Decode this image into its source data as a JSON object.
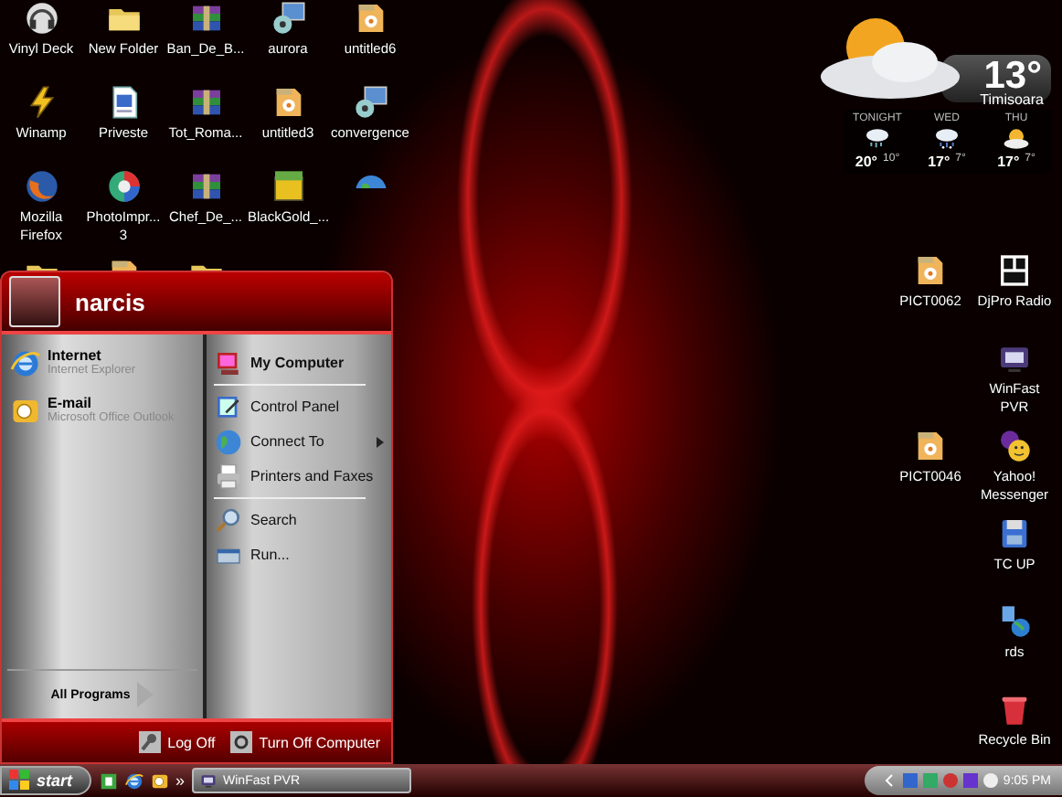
{
  "desktop_icons": [
    {
      "label": "Vinyl Deck",
      "kind": "headphones"
    },
    {
      "label": "New Folder",
      "kind": "folder"
    },
    {
      "label": "Ban_De_B...",
      "kind": "archive"
    },
    {
      "label": "aurora",
      "kind": "setup"
    },
    {
      "label": "untitled6",
      "kind": "media"
    },
    {
      "label": "Winamp",
      "kind": "winamp"
    },
    {
      "label": "Priveste",
      "kind": "document"
    },
    {
      "label": "Tot_Roma...",
      "kind": "archive"
    },
    {
      "label": "untitled3",
      "kind": "media"
    },
    {
      "label": "convergence",
      "kind": "setup"
    },
    {
      "label": "Mozilla Firefox",
      "kind": "browser"
    },
    {
      "label": "PhotoImpr... 3",
      "kind": "photo"
    },
    {
      "label": "Chef_De_...",
      "kind": "archive"
    },
    {
      "label": "BlackGold_...",
      "kind": "game"
    },
    {
      "kind": "globe"
    },
    {
      "kind": "folder"
    },
    {
      "kind": "media"
    },
    {
      "kind": "folder"
    }
  ],
  "right_icons_column_1": [
    {
      "label": "PICT0062",
      "kind": "media"
    },
    {
      "label": "PICT0046",
      "kind": "media"
    }
  ],
  "right_icons_column_2": [
    {
      "label": "DjPro Radio",
      "kind": "djlogo"
    },
    {
      "label": "WinFast PVR",
      "kind": "tv"
    },
    {
      "label": "Yahoo! Messenger",
      "kind": "messenger"
    },
    {
      "label": "TC UP",
      "kind": "disk"
    },
    {
      "label": "rds",
      "kind": "network"
    },
    {
      "label": "Recycle Bin",
      "kind": "trash"
    }
  ],
  "weather": {
    "temperature": "13°",
    "city": "Timisoara",
    "forecast": [
      {
        "day": "TONIGHT",
        "kind": "rain",
        "high": "20°",
        "low": "10°"
      },
      {
        "day": "WED",
        "kind": "snow",
        "high": "17°",
        "low": "7°"
      },
      {
        "day": "THU",
        "kind": "sunny",
        "high": "17°",
        "low": "7°"
      }
    ]
  },
  "start_menu": {
    "user": "narcis",
    "pinned": [
      {
        "title": "Internet",
        "subtitle": "Internet Explorer",
        "kind": "ie"
      },
      {
        "title": "E-mail",
        "subtitle": "Microsoft Office Outlook",
        "kind": "mail"
      }
    ],
    "all_programs": "All Programs",
    "places": [
      {
        "kind": "primary",
        "label": "My Computer"
      },
      {
        "kind": "divider"
      },
      {
        "kind": "link",
        "label": "Control Panel"
      },
      {
        "kind": "submenu",
        "label": "Connect To"
      },
      {
        "kind": "link",
        "label": "Printers and Faxes"
      },
      {
        "kind": "divider"
      },
      {
        "kind": "link",
        "label": "Search"
      },
      {
        "kind": "link",
        "label": "Run..."
      }
    ],
    "log_off": "Log Off",
    "turn_off": "Turn Off Computer"
  },
  "taskbar": {
    "start": "start",
    "quick_launch": [
      {
        "kind": "green"
      },
      {
        "kind": "ie"
      },
      {
        "kind": "mail"
      }
    ],
    "more": "»",
    "tasks": [
      {
        "label": "WinFast PVR",
        "kind": "tv"
      }
    ],
    "clock": "9:05 PM"
  }
}
